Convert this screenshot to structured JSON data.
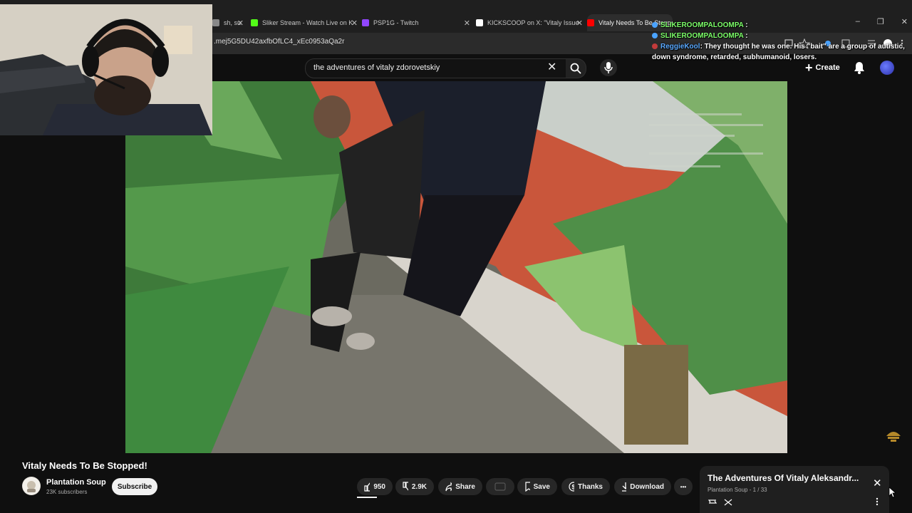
{
  "browser": {
    "tabs": [
      {
        "label": "sh, su",
        "fav": "#888"
      },
      {
        "label": "Sliker Stream - Watch Live on K",
        "fav": "#53fc18"
      },
      {
        "label": "PSP1G - Twitch",
        "fav": "#9146ff"
      },
      {
        "label": "KICKSCOOP on X: \"Vitaly Issue",
        "fav": "#ffffff"
      },
      {
        "label": "Vitaly Needs To Be Stopped!",
        "fav": "#ff0000"
      }
    ],
    "url": ".mej5G5DU42axfbOfLC4_xEc0953aQa2r",
    "window_controls": [
      "–",
      "❐",
      "✕"
    ]
  },
  "youtube": {
    "search_value": "the adventures of vitaly zdorovetskiy",
    "create_label": "Create"
  },
  "chat": [
    {
      "user": "SLIKEROOMPALOOMPA",
      "msg": "",
      "userColor": "#7dff6a"
    },
    {
      "user": "SLIKEROOMPALOOMPA",
      "msg": "",
      "userColor": "#7dff6a"
    },
    {
      "user": "ReggieKool",
      "msg": "They thought he was one. His \"bait\" are a group of autistic, down syndrome, retarded, subhumanoid, losers.",
      "userColor": "#5aa9ff"
    }
  ],
  "video": {
    "title": "Vitaly Needs To Be Stopped!",
    "channel": "Plantation Soup",
    "subscribers": "23K subscribers",
    "subscribe_label": "Subscribe",
    "likes": "950",
    "dislikes": "2.9K",
    "share_label": "Share",
    "save_label": "Save",
    "thanks_label": "Thanks",
    "download_label": "Download",
    "more_label": "•••"
  },
  "playlist": {
    "title": "The Adventures Of Vitaly Aleksandr...",
    "subtitle": "Plantation Soup - 1 / 33"
  },
  "colors": {
    "bg": "#0f0f0f",
    "accent_red": "#ff0000",
    "pill_bg": "#272727"
  }
}
